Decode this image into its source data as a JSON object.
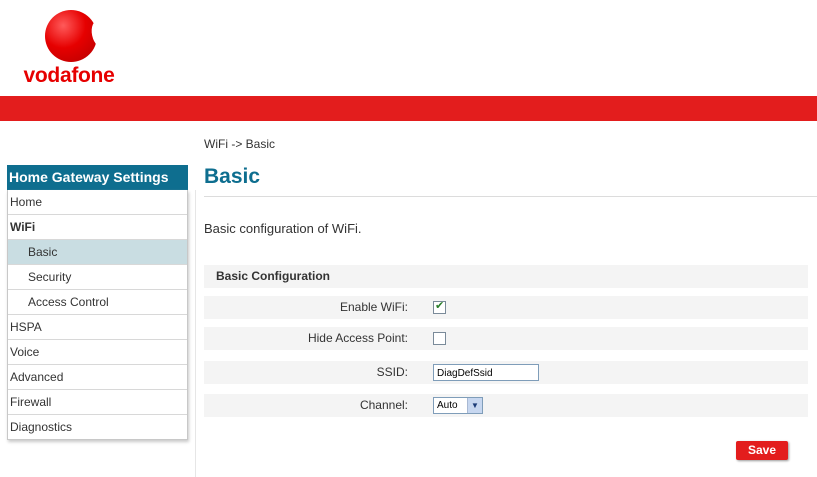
{
  "brand": {
    "logo_text": "vodafone",
    "accent": "#e31d1d",
    "title_color": "#0e6e8f"
  },
  "breadcrumb": "WiFi -> Basic",
  "page_title": "Basic",
  "description": "Basic configuration of WiFi.",
  "sidebar": {
    "title": "Home Gateway Settings",
    "items": [
      {
        "label": "Home"
      },
      {
        "label": "WiFi"
      },
      {
        "label": "Basic"
      },
      {
        "label": "Security"
      },
      {
        "label": "Access Control"
      },
      {
        "label": "HSPA"
      },
      {
        "label": "Voice"
      },
      {
        "label": "Advanced"
      },
      {
        "label": "Firewall"
      },
      {
        "label": "Diagnostics"
      }
    ]
  },
  "form": {
    "section_title": "Basic Configuration",
    "enable_wifi": {
      "label": "Enable WiFi:",
      "checked": true
    },
    "hide_ap": {
      "label": "Hide Access Point:",
      "checked": false
    },
    "ssid": {
      "label": "SSID:",
      "value": "DiagDefSsid"
    },
    "channel": {
      "label": "Channel:",
      "value": "Auto"
    }
  },
  "actions": {
    "save_label": "Save"
  }
}
